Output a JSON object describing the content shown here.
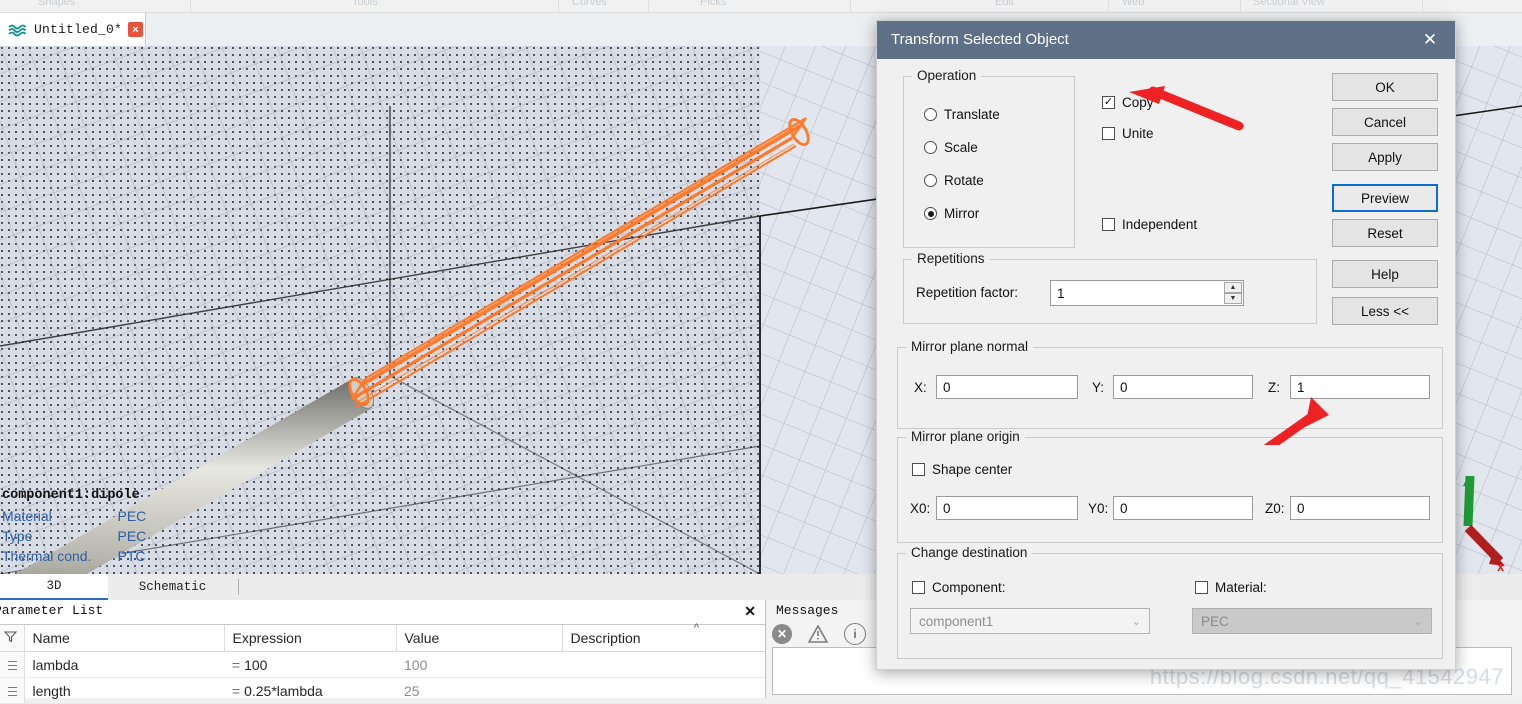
{
  "ribbon": {
    "tabs": [
      "Shapes",
      "Tools",
      "Curves",
      "Picks",
      "Edit",
      "Web",
      "Sectional View"
    ]
  },
  "document_tab": {
    "label": "Untitled_0*",
    "close_label": "×",
    "icon": "wave-icon"
  },
  "viewport": {
    "object_header": "component1:dipole",
    "properties": [
      {
        "key": "Material",
        "value": "PEC"
      },
      {
        "key": "Type",
        "value": "PEC"
      },
      {
        "key": "Thermal cond.",
        "value": "PTC"
      }
    ],
    "axis_x_label": "x",
    "colors": {
      "selection": "#ff7a2a",
      "axis_x": "#b01e1e",
      "axis_y": "#1e9c36"
    }
  },
  "view_tabs": [
    {
      "label": "3D",
      "active": true
    },
    {
      "label": "Schematic",
      "active": false
    }
  ],
  "parameter_list": {
    "title": "Parameter List",
    "close_label": "✕",
    "columns": [
      "Name",
      "Expression",
      "Value",
      "Description"
    ],
    "rows": [
      {
        "name": "lambda",
        "expression": "100",
        "value": "100",
        "description": ""
      },
      {
        "name": "length",
        "expression": "0.25*lambda",
        "value": "25",
        "description": ""
      }
    ],
    "filter_icon": "filter-icon",
    "sort_icon": "sort-ascending-icon"
  },
  "messages": {
    "title": "Messages",
    "icons": [
      {
        "name": "error-icon",
        "glyph": "✕",
        "color": "#8a8a8a"
      },
      {
        "name": "warning-icon",
        "glyph": "!",
        "color": "#8a8a8a"
      },
      {
        "name": "info-icon",
        "glyph": "i",
        "color": "#8a8a8a"
      }
    ],
    "body_text": ""
  },
  "watermark": "https://blog.csdn.net/qq_41542947",
  "dialog": {
    "title": "Transform Selected Object",
    "close_label": "✕",
    "title_bar_color": "#5d7086",
    "operation": {
      "legend": "Operation",
      "options": [
        {
          "label": "Translate",
          "selected": false
        },
        {
          "label": "Scale",
          "selected": false
        },
        {
          "label": "Rotate",
          "selected": false
        },
        {
          "label": "Mirror",
          "selected": true
        }
      ]
    },
    "flags": [
      {
        "label": "Copy",
        "checked": true
      },
      {
        "label": "Unite",
        "checked": false
      },
      {
        "label": "Independent",
        "checked": false
      }
    ],
    "repetitions": {
      "legend": "Repetitions",
      "factor_label": "Repetition factor:",
      "factor_value": "1",
      "spin_up": "▲",
      "spin_down": "▼"
    },
    "mirror_plane_normal": {
      "legend": "Mirror plane normal",
      "fields": [
        {
          "label": "X:",
          "value": "0"
        },
        {
          "label": "Y:",
          "value": "0"
        },
        {
          "label": "Z:",
          "value": "1"
        }
      ]
    },
    "mirror_plane_origin": {
      "legend": "Mirror plane origin",
      "shape_center_label": "Shape center",
      "shape_center_checked": false,
      "fields": [
        {
          "label": "X0:",
          "value": "0"
        },
        {
          "label": "Y0:",
          "value": "0"
        },
        {
          "label": "Z0:",
          "value": "0"
        }
      ]
    },
    "change_destination": {
      "legend": "Change destination",
      "component": {
        "label": "Component:",
        "checked": false,
        "value": "component1",
        "arrow": "⌄"
      },
      "material": {
        "label": "Material:",
        "checked": false,
        "value": "PEC",
        "arrow": "⌄"
      }
    },
    "buttons": [
      {
        "label": "OK",
        "default": false
      },
      {
        "label": "Cancel",
        "default": false
      },
      {
        "label": "Apply",
        "default": false
      },
      {
        "label": "Preview",
        "default": true
      },
      {
        "label": "Reset",
        "default": false
      },
      {
        "label": "Help",
        "default": false
      },
      {
        "label": "Less <<",
        "default": false
      }
    ],
    "annotations": [
      {
        "name": "copy-callout-arrow",
        "color": "#ee2222"
      },
      {
        "name": "z-field-callout-arrow",
        "color": "#ee2222"
      }
    ]
  }
}
